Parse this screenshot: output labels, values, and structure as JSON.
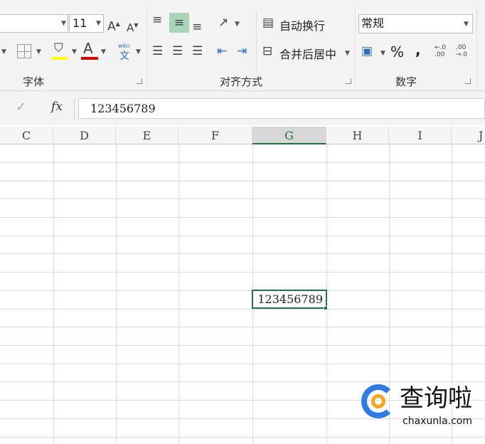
{
  "ribbon": {
    "font_size": "11",
    "font_group_label": "字体",
    "align_group_label": "对齐方式",
    "number_group_label": "数字",
    "wrap_text_label": "自动换行",
    "merge_center_label": "合并后居中",
    "number_format": "常规",
    "percent_label": "%",
    "comma_label": ",",
    "phonetic_label": "wén",
    "phonetic_char": "文",
    "fill_color": "#ffff00",
    "font_color": "#d00000",
    "accent": "#217346"
  },
  "formula_bar": {
    "cancel": "✓",
    "fx": "fx",
    "value": "123456789"
  },
  "columns": [
    "C",
    "D",
    "E",
    "F",
    "G",
    "H",
    "I",
    "J"
  ],
  "selected_column": "G",
  "selected_cell_value": "123456789",
  "watermark": {
    "brand": "查询啦",
    "domain": "chaxunla.com"
  }
}
